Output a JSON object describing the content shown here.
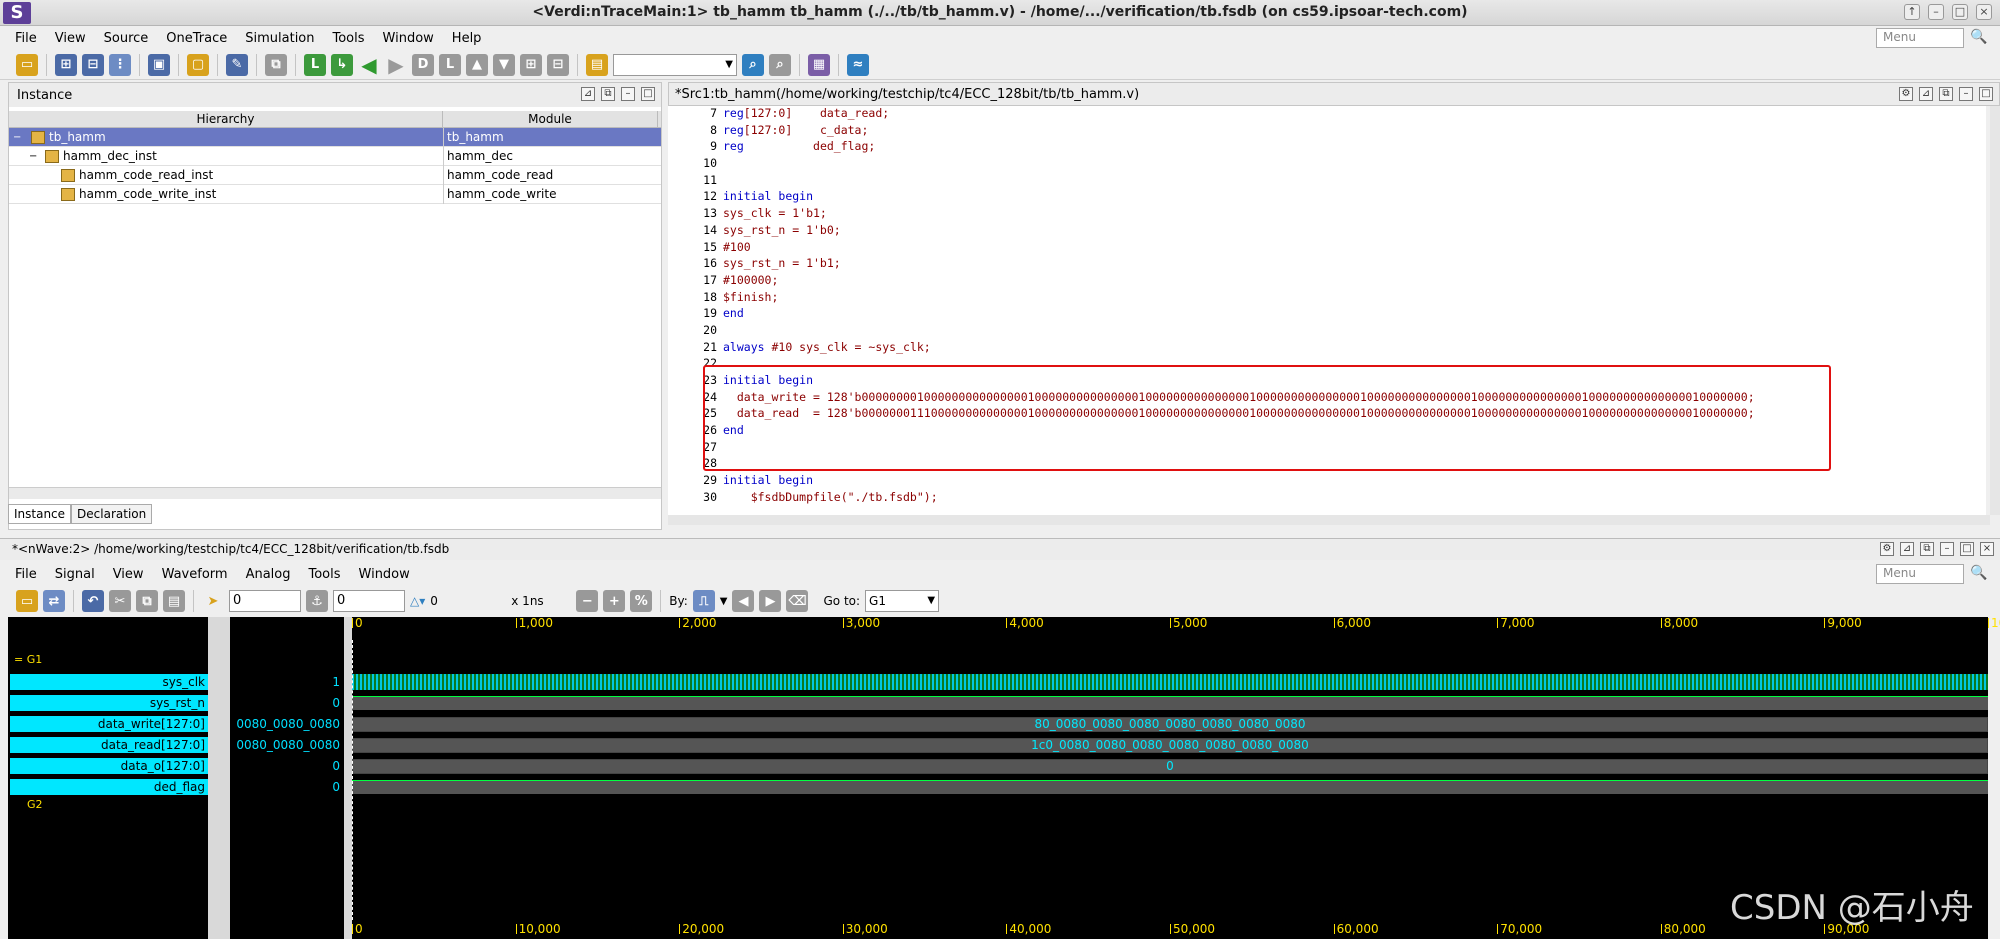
{
  "window": {
    "title": "<Verdi:nTraceMain:1> tb_hamm tb_hamm (./../tb/tb_hamm.v) - /home/.../verification/tb.fsdb (on cs59.ipsoar-tech.com)",
    "logo": "S"
  },
  "menus": [
    "File",
    "View",
    "Source",
    "OneTrace",
    "Simulation",
    "Tools",
    "Window",
    "Help"
  ],
  "menu_search_placeholder": "Menu",
  "instance_panel": {
    "title": "Instance",
    "col_hierarchy": "Hierarchy",
    "col_module": "Module",
    "rows": [
      {
        "name": "tb_hamm",
        "module": "tb_hamm",
        "indent": 0,
        "expander": "−"
      },
      {
        "name": "hamm_dec_inst",
        "module": "hamm_dec",
        "indent": 1,
        "expander": "−"
      },
      {
        "name": "hamm_code_read_inst",
        "module": "hamm_code_read",
        "indent": 2,
        "expander": ""
      },
      {
        "name": "hamm_code_write_inst",
        "module": "hamm_code_write",
        "indent": 2,
        "expander": ""
      }
    ],
    "tabs": [
      "Instance",
      "Declaration"
    ]
  },
  "source_panel": {
    "title": "*Src1:tb_hamm(/home/working/testchip/tc4/ECC_128bit/tb/tb_hamm.v)",
    "lines": [
      {
        "n": "7",
        "t": "reg[127:0]    data_read;"
      },
      {
        "n": "8",
        "t": "reg[127:0]    c_data;"
      },
      {
        "n": "9",
        "t": "reg          ded_flag;"
      },
      {
        "n": "10",
        "t": ""
      },
      {
        "n": "11",
        "t": ""
      },
      {
        "n": "12",
        "t": "initial begin"
      },
      {
        "n": "13",
        "t": "sys_clk = 1'b1;"
      },
      {
        "n": "14",
        "t": "sys_rst_n = 1'b0;"
      },
      {
        "n": "15",
        "t": "#100"
      },
      {
        "n": "16",
        "t": "sys_rst_n = 1'b1;"
      },
      {
        "n": "17",
        "t": "#100000;"
      },
      {
        "n": "18",
        "t": "$finish;"
      },
      {
        "n": "19",
        "t": "end"
      },
      {
        "n": "20",
        "t": ""
      },
      {
        "n": "21",
        "t": "always #10 sys_clk = ~sys_clk;"
      },
      {
        "n": "22",
        "t": ""
      },
      {
        "n": "23",
        "t": "initial begin"
      },
      {
        "n": "24",
        "t": "  data_write = 128'b00000000100000000000000010000000000000001000000000000000100000000000000010000000000000001000000000000000100000000000000010000000;"
      },
      {
        "n": "25",
        "t": "  data_read  = 128'b00000001110000000000000010000000000000001000000000000000100000000000000010000000000000001000000000000000100000000000000010000000;"
      },
      {
        "n": "26",
        "t": "end"
      },
      {
        "n": "27",
        "t": ""
      },
      {
        "n": "28",
        "t": ""
      },
      {
        "n": "29",
        "t": "initial begin"
      },
      {
        "n": "30",
        "t": "    $fsdbDumpfile(\"./tb.fsdb\");"
      }
    ]
  },
  "wave_window": {
    "title": "*<nWave:2> /home/working/testchip/tc4/ECC_128bit/verification/tb.fsdb",
    "menus": [
      "File",
      "Signal",
      "View",
      "Waveform",
      "Analog",
      "Tools",
      "Window"
    ],
    "cursor_value": "0",
    "marker_value": "0",
    "delta_value": "0",
    "time_unit": "x 1ns",
    "by_label": "By:",
    "goto_label": "Go to:",
    "goto_value": "G1",
    "groups": [
      "G1",
      "G2"
    ],
    "signals": [
      {
        "name": "sys_clk",
        "value": "1"
      },
      {
        "name": "sys_rst_n",
        "value": "0"
      },
      {
        "name": "data_write[127:0]",
        "value": "0080_0080_0080"
      },
      {
        "name": "data_read[127:0]",
        "value": "0080_0080_0080"
      },
      {
        "name": "data_o[127:0]",
        "value": "0"
      },
      {
        "name": "ded_flag",
        "value": "0"
      }
    ],
    "bus_values": [
      "80_0080_0080_0080_0080_0080_0080_0080",
      "1c0_0080_0080_0080_0080_0080_0080_0080",
      "0"
    ],
    "top_ruler": [
      "0",
      "1,000",
      "2,000",
      "3,000",
      "4,000",
      "5,000",
      "6,000",
      "7,000",
      "8,000",
      "9,000",
      "10"
    ],
    "bottom_ruler": [
      "0",
      "10,000",
      "20,000",
      "30,000",
      "40,000",
      "50,000",
      "60,000",
      "70,000",
      "80,000",
      "90,000"
    ]
  },
  "watermark": "CSDN @石小舟",
  "colors": {
    "signal_bg": "#00e7ff",
    "clock": "#00c8e0",
    "highlight_box": "#e01010",
    "selection": "#6a78c3"
  }
}
